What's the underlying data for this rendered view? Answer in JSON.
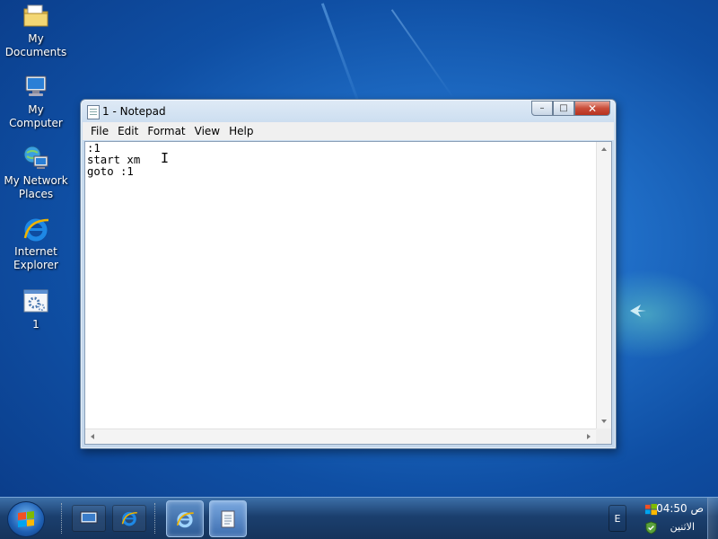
{
  "desktop": {
    "icons": [
      {
        "label": "My\nDocuments",
        "line1": "My",
        "line2": "Documents",
        "icon": "folder-icon"
      },
      {
        "line1": "My Computer",
        "icon": "computer-icon"
      },
      {
        "line1": "My Network",
        "line2": "Places",
        "icon": "network-icon"
      },
      {
        "line1": "Internet",
        "line2": "Explorer",
        "icon": "internet-explorer-icon"
      },
      {
        "line1": "1",
        "icon": "batch-file-icon"
      }
    ]
  },
  "window": {
    "title": "1 - Notepad",
    "menu": [
      "File",
      "Edit",
      "Format",
      "View",
      "Help"
    ],
    "content": ":1\nstart xm\ngoto :1",
    "caption": {
      "minimize": "–",
      "maximize": "□",
      "close": "✕"
    }
  },
  "taskbar": {
    "tray_button_label": "E",
    "clock_time": "04:50 ص",
    "clock_day": "الاثنين",
    "colors": {
      "accent": "#1b3f6e",
      "start_orb": "#1e5fb3"
    }
  }
}
